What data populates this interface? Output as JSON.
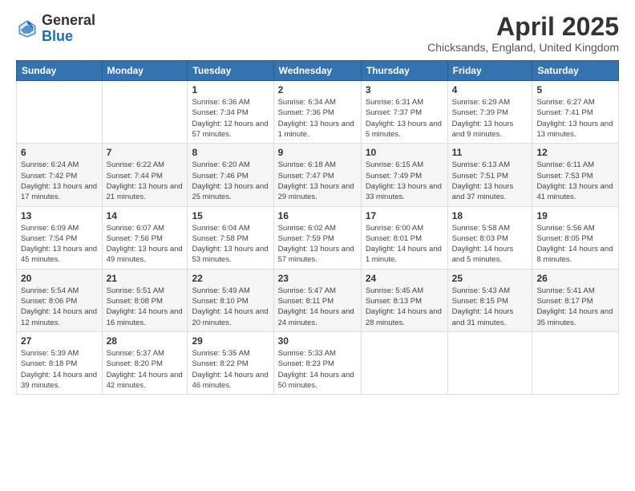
{
  "header": {
    "logo_general": "General",
    "logo_blue": "Blue",
    "title": "April 2025",
    "subtitle": "Chicksands, England, United Kingdom"
  },
  "columns": [
    "Sunday",
    "Monday",
    "Tuesday",
    "Wednesday",
    "Thursday",
    "Friday",
    "Saturday"
  ],
  "weeks": [
    [
      {
        "day": "",
        "info": ""
      },
      {
        "day": "",
        "info": ""
      },
      {
        "day": "1",
        "info": "Sunrise: 6:36 AM\nSunset: 7:34 PM\nDaylight: 12 hours and 57 minutes."
      },
      {
        "day": "2",
        "info": "Sunrise: 6:34 AM\nSunset: 7:36 PM\nDaylight: 13 hours and 1 minute."
      },
      {
        "day": "3",
        "info": "Sunrise: 6:31 AM\nSunset: 7:37 PM\nDaylight: 13 hours and 5 minutes."
      },
      {
        "day": "4",
        "info": "Sunrise: 6:29 AM\nSunset: 7:39 PM\nDaylight: 13 hours and 9 minutes."
      },
      {
        "day": "5",
        "info": "Sunrise: 6:27 AM\nSunset: 7:41 PM\nDaylight: 13 hours and 13 minutes."
      }
    ],
    [
      {
        "day": "6",
        "info": "Sunrise: 6:24 AM\nSunset: 7:42 PM\nDaylight: 13 hours and 17 minutes."
      },
      {
        "day": "7",
        "info": "Sunrise: 6:22 AM\nSunset: 7:44 PM\nDaylight: 13 hours and 21 minutes."
      },
      {
        "day": "8",
        "info": "Sunrise: 6:20 AM\nSunset: 7:46 PM\nDaylight: 13 hours and 25 minutes."
      },
      {
        "day": "9",
        "info": "Sunrise: 6:18 AM\nSunset: 7:47 PM\nDaylight: 13 hours and 29 minutes."
      },
      {
        "day": "10",
        "info": "Sunrise: 6:15 AM\nSunset: 7:49 PM\nDaylight: 13 hours and 33 minutes."
      },
      {
        "day": "11",
        "info": "Sunrise: 6:13 AM\nSunset: 7:51 PM\nDaylight: 13 hours and 37 minutes."
      },
      {
        "day": "12",
        "info": "Sunrise: 6:11 AM\nSunset: 7:53 PM\nDaylight: 13 hours and 41 minutes."
      }
    ],
    [
      {
        "day": "13",
        "info": "Sunrise: 6:09 AM\nSunset: 7:54 PM\nDaylight: 13 hours and 45 minutes."
      },
      {
        "day": "14",
        "info": "Sunrise: 6:07 AM\nSunset: 7:56 PM\nDaylight: 13 hours and 49 minutes."
      },
      {
        "day": "15",
        "info": "Sunrise: 6:04 AM\nSunset: 7:58 PM\nDaylight: 13 hours and 53 minutes."
      },
      {
        "day": "16",
        "info": "Sunrise: 6:02 AM\nSunset: 7:59 PM\nDaylight: 13 hours and 57 minutes."
      },
      {
        "day": "17",
        "info": "Sunrise: 6:00 AM\nSunset: 8:01 PM\nDaylight: 14 hours and 1 minute."
      },
      {
        "day": "18",
        "info": "Sunrise: 5:58 AM\nSunset: 8:03 PM\nDaylight: 14 hours and 5 minutes."
      },
      {
        "day": "19",
        "info": "Sunrise: 5:56 AM\nSunset: 8:05 PM\nDaylight: 14 hours and 8 minutes."
      }
    ],
    [
      {
        "day": "20",
        "info": "Sunrise: 5:54 AM\nSunset: 8:06 PM\nDaylight: 14 hours and 12 minutes."
      },
      {
        "day": "21",
        "info": "Sunrise: 5:51 AM\nSunset: 8:08 PM\nDaylight: 14 hours and 16 minutes."
      },
      {
        "day": "22",
        "info": "Sunrise: 5:49 AM\nSunset: 8:10 PM\nDaylight: 14 hours and 20 minutes."
      },
      {
        "day": "23",
        "info": "Sunrise: 5:47 AM\nSunset: 8:11 PM\nDaylight: 14 hours and 24 minutes."
      },
      {
        "day": "24",
        "info": "Sunrise: 5:45 AM\nSunset: 8:13 PM\nDaylight: 14 hours and 28 minutes."
      },
      {
        "day": "25",
        "info": "Sunrise: 5:43 AM\nSunset: 8:15 PM\nDaylight: 14 hours and 31 minutes."
      },
      {
        "day": "26",
        "info": "Sunrise: 5:41 AM\nSunset: 8:17 PM\nDaylight: 14 hours and 35 minutes."
      }
    ],
    [
      {
        "day": "27",
        "info": "Sunrise: 5:39 AM\nSunset: 8:18 PM\nDaylight: 14 hours and 39 minutes."
      },
      {
        "day": "28",
        "info": "Sunrise: 5:37 AM\nSunset: 8:20 PM\nDaylight: 14 hours and 42 minutes."
      },
      {
        "day": "29",
        "info": "Sunrise: 5:35 AM\nSunset: 8:22 PM\nDaylight: 14 hours and 46 minutes."
      },
      {
        "day": "30",
        "info": "Sunrise: 5:33 AM\nSunset: 8:23 PM\nDaylight: 14 hours and 50 minutes."
      },
      {
        "day": "",
        "info": ""
      },
      {
        "day": "",
        "info": ""
      },
      {
        "day": "",
        "info": ""
      }
    ]
  ]
}
